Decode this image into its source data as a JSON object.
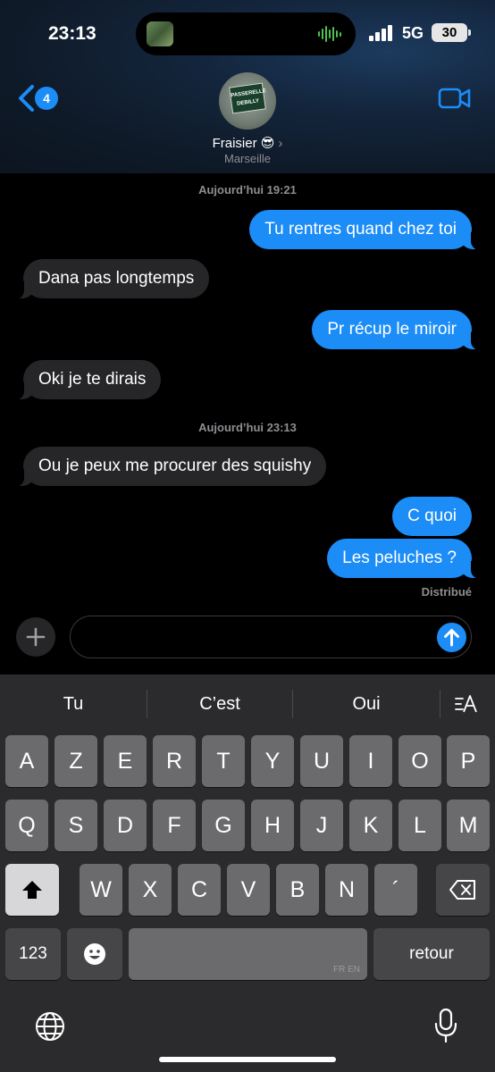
{
  "status_bar": {
    "time": "23:13",
    "network": "5G",
    "battery": "30"
  },
  "header": {
    "back_badge": "4",
    "contact_name": "Fraisier 😎",
    "contact_subtitle": "Marseille",
    "avatar_sign_text": "PASSERELLE DEBILLY"
  },
  "conversation": {
    "timestamps": [
      "Aujourd’hui 19:21",
      "Aujourd’hui 23:13"
    ],
    "messages": [
      {
        "text": "Tu rentres quand chez toi",
        "direction": "outgoing"
      },
      {
        "text": "Dana pas longtemps",
        "direction": "incoming"
      },
      {
        "text": "Pr récup le miroir",
        "direction": "outgoing"
      },
      {
        "text": "Oki je te dirais",
        "direction": "incoming"
      },
      {
        "text": "Ou je peux me procurer des squishy",
        "direction": "incoming"
      },
      {
        "text": "C quoi",
        "direction": "outgoing"
      },
      {
        "text": "Les peluches ?",
        "direction": "outgoing"
      }
    ],
    "delivery_status": "Distribué"
  },
  "composer": {
    "value": "",
    "icons": [
      "plus-icon",
      "send-arrow-icon"
    ]
  },
  "keyboard": {
    "suggestions": [
      "Tu",
      "C’est",
      "Oui"
    ],
    "row1": [
      "A",
      "Z",
      "E",
      "R",
      "T",
      "Y",
      "U",
      "I",
      "O",
      "P"
    ],
    "row2": [
      "Q",
      "S",
      "D",
      "F",
      "G",
      "H",
      "J",
      "K",
      "L",
      "M"
    ],
    "row3": [
      "W",
      "X",
      "C",
      "V",
      "B",
      "N",
      "´"
    ],
    "numbers_key": "123",
    "return_key": "retour",
    "space_languages": "FR EN"
  },
  "colors": {
    "accent": "#1c8cf7",
    "incoming_bubble": "#262628",
    "keyboard_bg": "#2b2b2d",
    "key": "#6b6b6d"
  }
}
